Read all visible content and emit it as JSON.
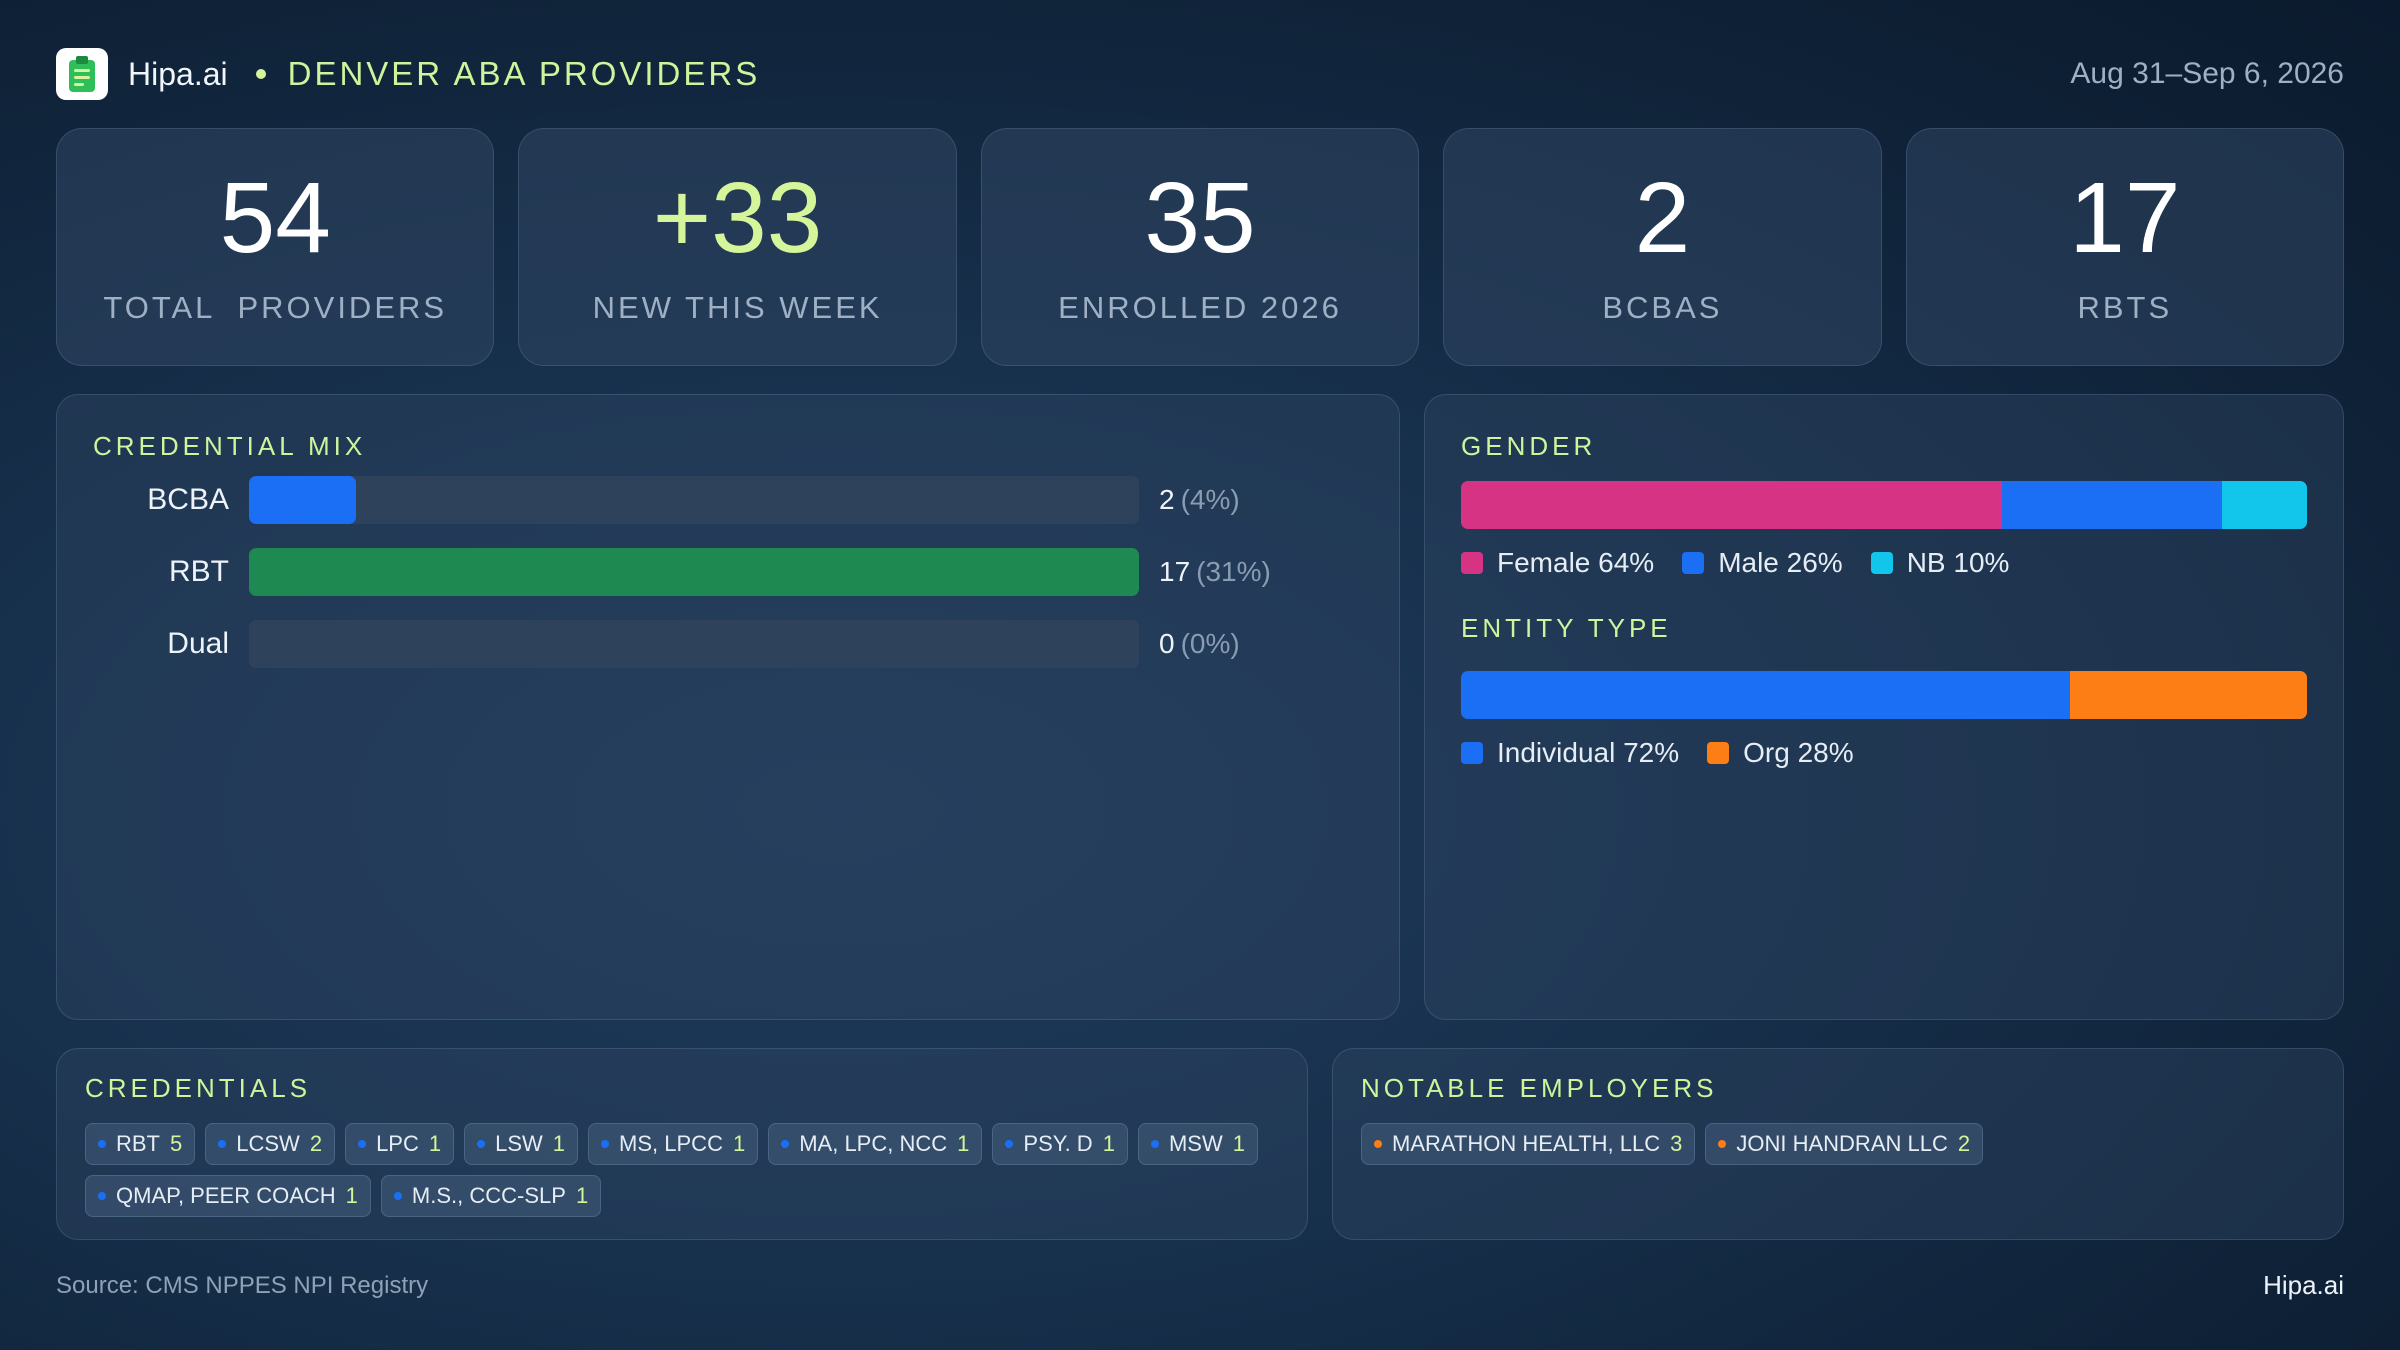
{
  "header": {
    "brand": "Hipa.ai",
    "region": "DENVER ABA PROVIDERS",
    "date_range": "Aug 31–Sep 6, 2026",
    "logo_icon": "clipboard-icon"
  },
  "stats": [
    {
      "value": "54",
      "label": "TOTAL  PROVIDERS"
    },
    {
      "value": "+33",
      "label": "NEW THIS WEEK"
    },
    {
      "value": "35",
      "label": "ENROLLED 2026"
    },
    {
      "value": "2",
      "label": "BCBAS"
    },
    {
      "value": "17",
      "label": "RBTS"
    }
  ],
  "credential_mix": {
    "title": "CREDENTIAL MIX",
    "rows": [
      {
        "label": "BCBA",
        "count": "2",
        "pct": "(4%)",
        "fill": 0.12,
        "color": "#1a6ff5"
      },
      {
        "label": "RBT",
        "count": "17",
        "pct": "(31%)",
        "fill": 1.0,
        "color": "#1e8a52"
      },
      {
        "label": "Dual",
        "count": "0",
        "pct": "(0%)",
        "fill": 0.0,
        "color": "#1a6ff5"
      }
    ]
  },
  "gender": {
    "title": "GENDER",
    "segments": [
      {
        "label": "Female 64%",
        "value": 64,
        "color": "#d63384"
      },
      {
        "label": "Male 26%",
        "value": 26,
        "color": "#1a6ff5"
      },
      {
        "label": "NB 10%",
        "value": 10,
        "color": "#12c5ea"
      }
    ]
  },
  "entity_type": {
    "title": "ENTITY TYPE",
    "segments": [
      {
        "label": "Individual 72%",
        "value": 72,
        "color": "#1a6ff5"
      },
      {
        "label": "Org 28%",
        "value": 28,
        "color": "#fd7e14"
      }
    ]
  },
  "credentials": {
    "title": "CREDENTIALS",
    "dot_color": "#1a6ff5",
    "items": [
      {
        "name": "RBT",
        "count": "5"
      },
      {
        "name": "LCSW",
        "count": "2"
      },
      {
        "name": "LPC",
        "count": "1"
      },
      {
        "name": "LSW",
        "count": "1"
      },
      {
        "name": "MS, LPCC",
        "count": "1"
      },
      {
        "name": "MA, LPC, NCC",
        "count": "1"
      },
      {
        "name": "PSY. D",
        "count": "1"
      },
      {
        "name": "MSW",
        "count": "1"
      },
      {
        "name": "QMAP, PEER COACH",
        "count": "1"
      },
      {
        "name": "M.S., CCC-SLP",
        "count": "1"
      }
    ]
  },
  "employers": {
    "title": "NOTABLE EMPLOYERS",
    "dot_color": "#fd7e14",
    "items": [
      {
        "name": "MARATHON HEALTH, LLC",
        "count": "3"
      },
      {
        "name": "JONI HANDRAN LLC",
        "count": "2"
      }
    ]
  },
  "footer": {
    "source": "Source: CMS NPPES NPI Registry",
    "brand": "Hipa.ai"
  }
}
